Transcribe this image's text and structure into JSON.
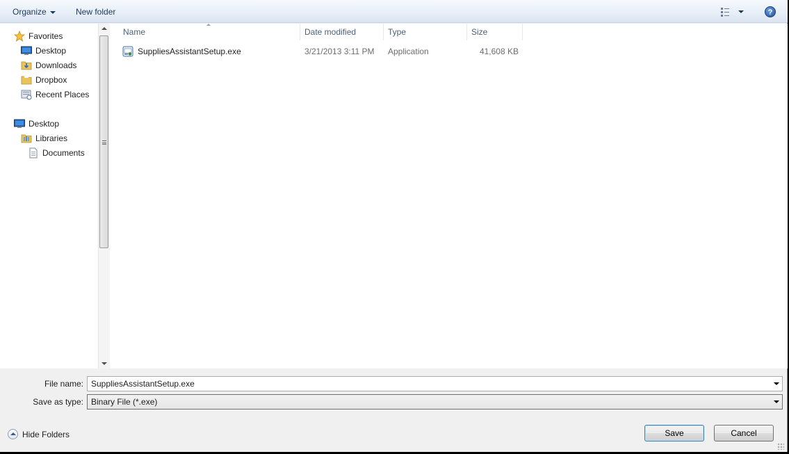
{
  "toolbar": {
    "organize_label": "Organize",
    "new_folder_label": "New folder",
    "views_icon": "views-list-icon",
    "help_label": "?"
  },
  "nav": {
    "favorites": {
      "label": "Favorites",
      "items": [
        {
          "label": "Desktop",
          "icon": "desktop-icon"
        },
        {
          "label": "Downloads",
          "icon": "downloads-folder-icon"
        },
        {
          "label": "Dropbox",
          "icon": "dropbox-folder-icon"
        },
        {
          "label": "Recent Places",
          "icon": "recent-places-icon"
        }
      ]
    },
    "tree": {
      "root_label": "Desktop",
      "libraries_label": "Libraries",
      "documents_label": "Documents"
    }
  },
  "list": {
    "columns": [
      "Name",
      "Date modified",
      "Type",
      "Size"
    ],
    "files": [
      {
        "name": "SuppliesAssistantSetup.exe",
        "date": "3/21/2013 3:11 PM",
        "type": "Application",
        "size": "41,608 KB",
        "icon": "application-installer-icon"
      }
    ]
  },
  "form": {
    "file_name_label": "File name:",
    "file_name_value": "SuppliesAssistantSetup.exe",
    "save_type_label": "Save as type:",
    "save_type_value": "Binary File (*.exe)"
  },
  "footer": {
    "hide_folders_label": "Hide Folders",
    "save_label": "Save",
    "cancel_label": "Cancel"
  },
  "colors": {
    "toolbar_text": "#1e395b",
    "secondary_text": "#6d6d6d",
    "header_text": "#4c607a"
  }
}
